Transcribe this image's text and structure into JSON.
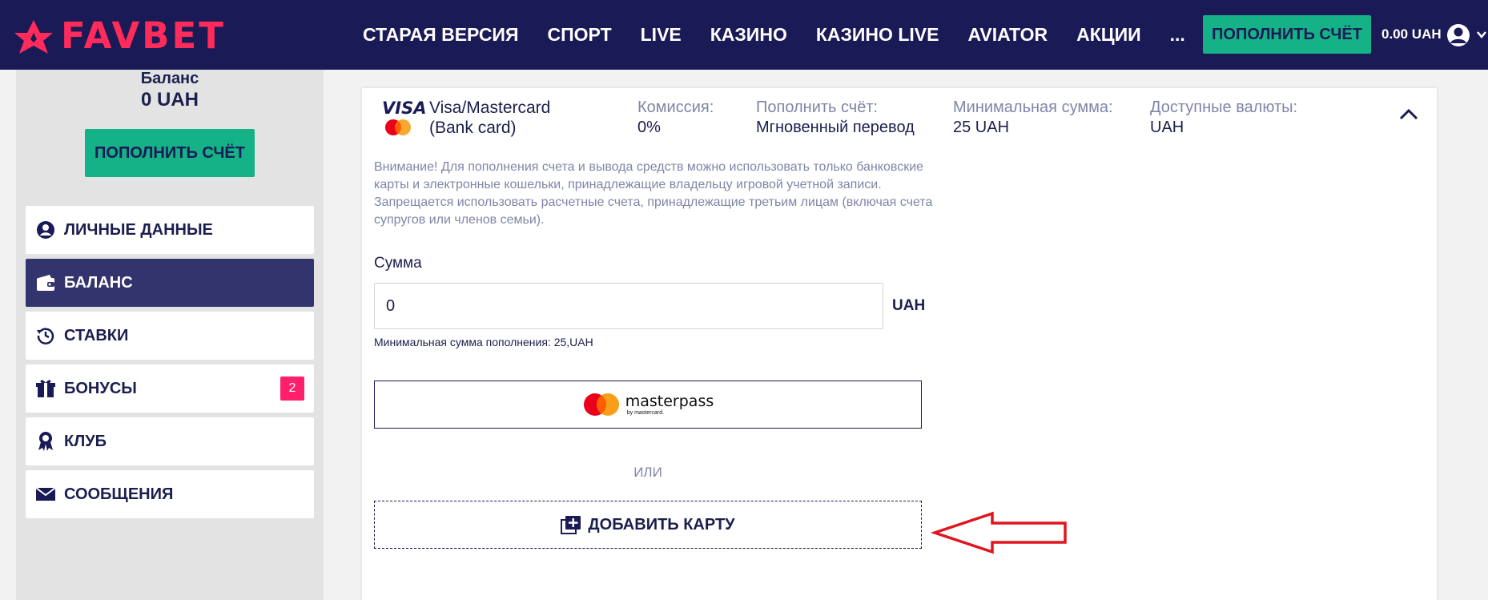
{
  "header": {
    "logo": "FAVBET",
    "nav": [
      "СТАРАЯ ВЕРСИЯ",
      "СПОРТ",
      "LIVE",
      "КАЗИНО",
      "КАЗИНО LIVE",
      "AVIATOR",
      "АКЦИИ"
    ],
    "more": "...",
    "deposit_button": "ПОПОЛНИТЬ СЧЁТ",
    "balance": "0.00 UAH"
  },
  "sidebar": {
    "balance_label": "Баланс",
    "balance_value": "0 UAH",
    "deposit_button": "ПОПОЛНИТЬ СЧЁТ",
    "menu": [
      {
        "label": "ЛИЧНЫЕ ДАННЫЕ",
        "icon": "user-icon"
      },
      {
        "label": "БАЛАНС",
        "icon": "wallet-icon",
        "active": true
      },
      {
        "label": "СТАВКИ",
        "icon": "history-icon"
      },
      {
        "label": "БОНУСЫ",
        "icon": "gift-icon",
        "badge": "2"
      },
      {
        "label": "КЛУБ",
        "icon": "award-icon"
      },
      {
        "label": "СООБЩЕНИЯ",
        "icon": "envelope-icon"
      }
    ]
  },
  "payment": {
    "visa_text": "VISA",
    "method_name": "Visa/Mastercard (Bank card)",
    "commission_label": "Комиссия:",
    "commission_value": "0%",
    "deposit_label": "Пополнить счёт:",
    "deposit_value": "Мгновенный перевод",
    "min_label": "Минимальная сумма:",
    "min_value": "25 UAH",
    "currencies_label": "Доступные валюты:",
    "currencies_value": "UAH",
    "warning": "Внимание! Для пополнения счета и вывода средств можно использовать только банковские карты и электронные кошельки, принадлежащие владельцу игровой учетной записи. Запрещается использовать расчетные счета, принадлежащие третьим лицам (включая счета супругов или членов семьи).",
    "sum_label": "Сумма",
    "sum_value": "0",
    "currency": "UAH",
    "min_note": "Минимальная сумма пополнения: 25,UAH",
    "masterpass_name": "masterpass",
    "masterpass_sub": "by mastercard.",
    "or": "ИЛИ",
    "add_card": "ДОБАВИТЬ КАРТУ"
  },
  "colors": {
    "navy": "#1a1a56",
    "green": "#14b286",
    "brand_pink": "#ff2b5a",
    "active_menu": "#33346d",
    "badge": "#ff1f6b",
    "annotation_arrow": "#e0161e"
  }
}
